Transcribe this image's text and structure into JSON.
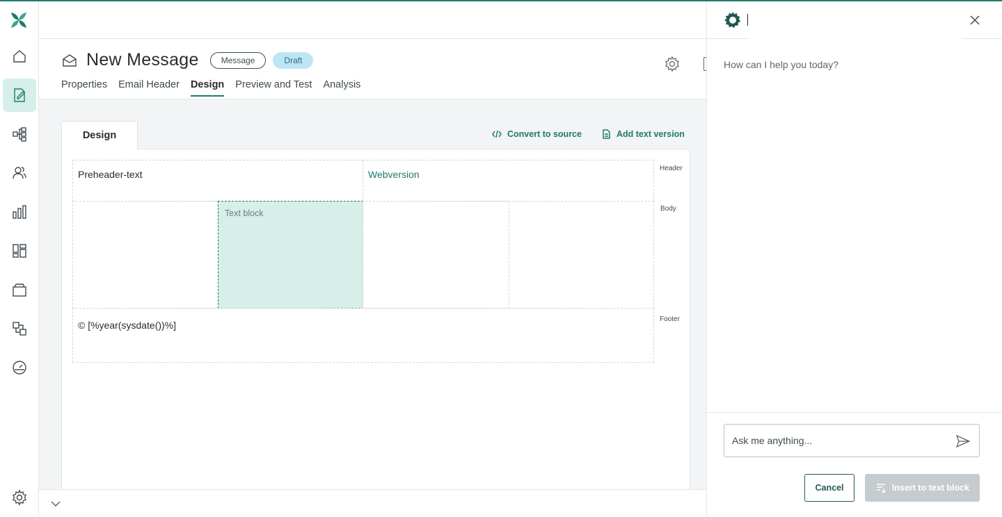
{
  "app": {
    "accent": "#1e7a6c",
    "draft_badge_color": "#bde6f5",
    "selected_block_color": "#d6efe9"
  },
  "rail": {
    "items": [
      {
        "name": "home-icon",
        "active": false
      },
      {
        "name": "edit-message-icon",
        "active": true
      },
      {
        "name": "workflow-icon",
        "active": false
      },
      {
        "name": "users-icon",
        "active": false
      },
      {
        "name": "analytics-icon",
        "active": false
      },
      {
        "name": "dashboard-icon",
        "active": false
      },
      {
        "name": "archive-icon",
        "active": false
      },
      {
        "name": "integrations-icon",
        "active": false
      },
      {
        "name": "gauge-icon",
        "active": false
      }
    ],
    "settings_icon": "gear-icon"
  },
  "header": {
    "title": "New Message",
    "badge_type": "Message",
    "badge_status": "Draft",
    "tabs": [
      {
        "label": "Properties",
        "active": false
      },
      {
        "label": "Email Header",
        "active": false
      },
      {
        "label": "Design",
        "active": true
      },
      {
        "label": "Preview and Test",
        "active": false
      },
      {
        "label": "Analysis",
        "active": false
      }
    ]
  },
  "editor": {
    "tab_label": "Design",
    "convert_label": "Convert to source",
    "add_text_label": "Add text version",
    "preheader": "Preheader-text",
    "webversion": "Webversion",
    "text_block": "Text block",
    "footer_text": "© [%year(sysdate())%]",
    "labels": {
      "header": "Header",
      "body": "Body",
      "footer": "Footer"
    }
  },
  "assistant": {
    "greeting": "How can I help you today?",
    "input_placeholder": "Ask me anything...",
    "input_value": "",
    "cancel_label": "Cancel",
    "insert_label": "Insert to text block"
  }
}
